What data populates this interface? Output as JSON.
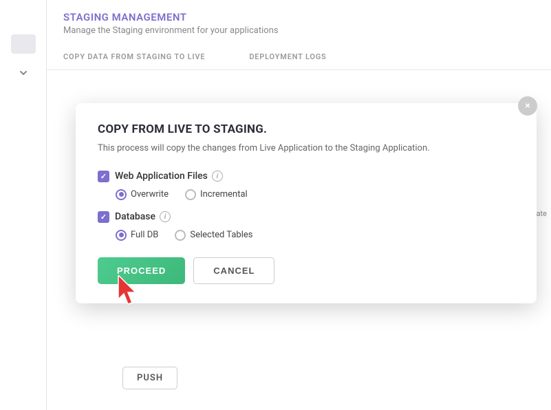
{
  "page": {
    "topbar_color": "#7c6fcd"
  },
  "header": {
    "title": "STAGING MANAGEMENT",
    "subtitle": "Manage the Staging environment for your applications"
  },
  "tabs": [
    {
      "label": "COPY DATA FROM STAGING TO LIVE",
      "active": false
    },
    {
      "label": "DEPLOYMENT LOGS",
      "active": false
    }
  ],
  "modal": {
    "title": "COPY FROM LIVE TO STAGING.",
    "description": "This process will copy the changes from Live Application to the Staging Application.",
    "close_label": "×",
    "options": {
      "web_app_files": {
        "label": "Web Application Files",
        "checked": true,
        "sub_options": [
          {
            "label": "Overwrite",
            "selected": true
          },
          {
            "label": "Incremental",
            "selected": false
          }
        ]
      },
      "database": {
        "label": "Database",
        "checked": true,
        "sub_options": [
          {
            "label": "Full DB",
            "selected": true
          },
          {
            "label": "Selected Tables",
            "selected": false
          }
        ]
      }
    },
    "buttons": {
      "proceed": "PROCEED",
      "cancel": "CANCEL"
    }
  },
  "background": {
    "push_button": "PUSH",
    "right_text": "us state"
  }
}
